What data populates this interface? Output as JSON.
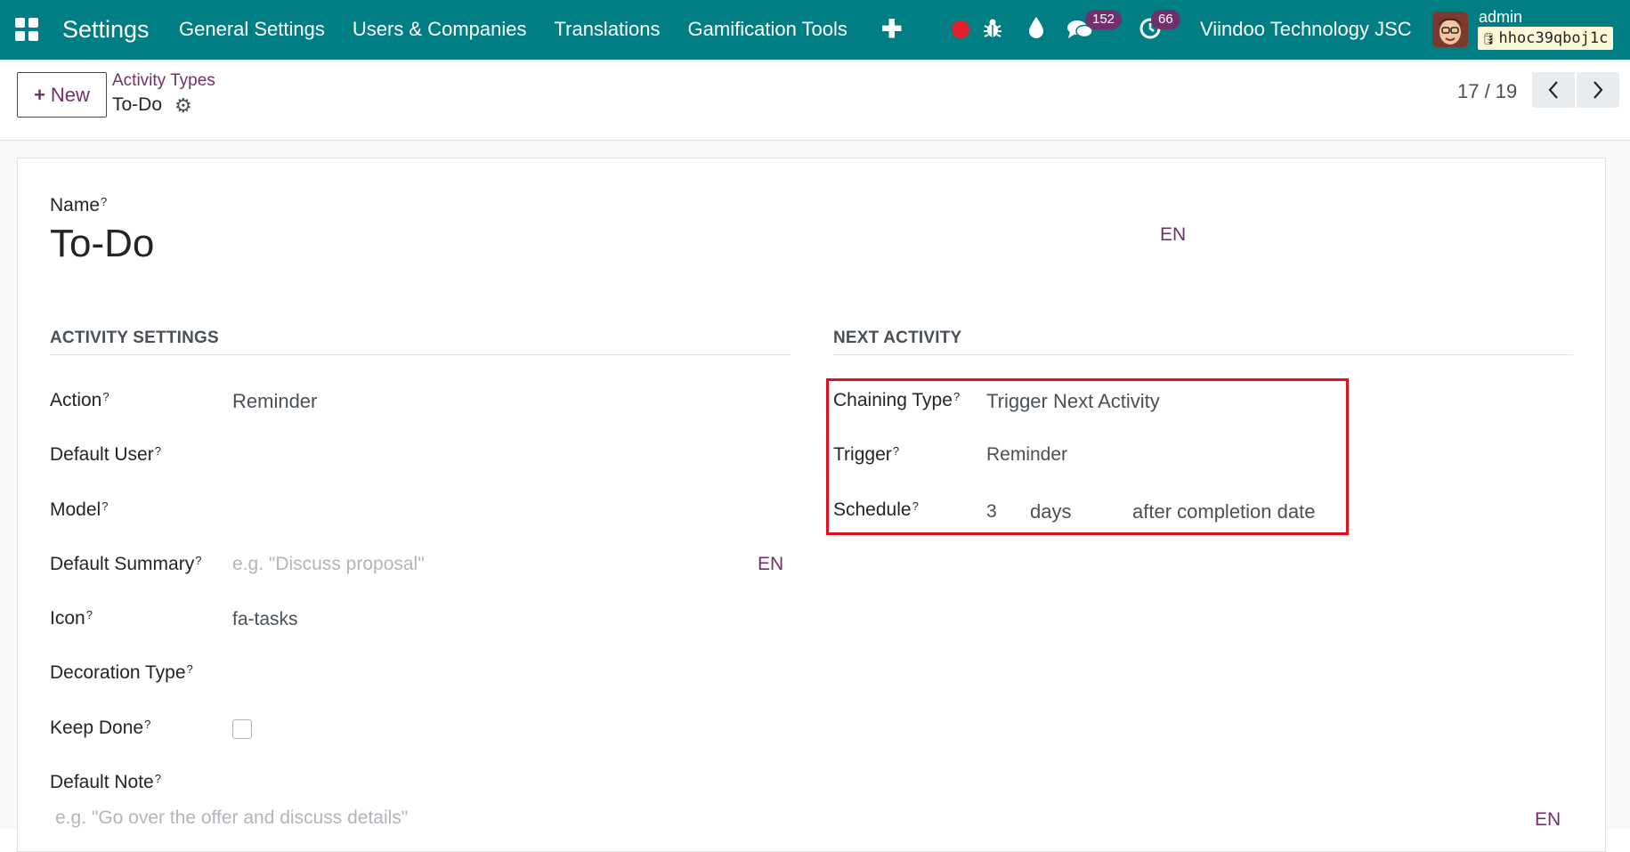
{
  "navbar": {
    "app_title": "Settings",
    "menu": [
      "General Settings",
      "Users & Companies",
      "Translations",
      "Gamification Tools"
    ],
    "messages_count": "152",
    "activities_count": "66",
    "company": "Viindoo Technology JSC",
    "user_name": "admin",
    "database": "hhoc39qboj1c",
    "colors": {
      "bar": "#017e84",
      "badge": "#71306b",
      "record": "#e0202a"
    }
  },
  "control_panel": {
    "new_label": "New",
    "breadcrumb_parent": "Activity Types",
    "breadcrumb_current": "To-Do",
    "pager": "17 / 19"
  },
  "form": {
    "name_label": "Name",
    "name_value": "To-Do",
    "name_lang": "EN",
    "activity_settings": {
      "title": "ACTIVITY SETTINGS",
      "action_label": "Action",
      "action_value": "Reminder",
      "default_user_label": "Default User",
      "model_label": "Model",
      "default_summary_label": "Default Summary",
      "default_summary_placeholder": "e.g. \"Discuss proposal\"",
      "default_summary_lang": "EN",
      "icon_label": "Icon",
      "icon_value": "fa-tasks",
      "decoration_type_label": "Decoration Type",
      "keep_done_label": "Keep Done",
      "keep_done_checked": false,
      "default_note_label": "Default Note",
      "default_note_placeholder": "e.g. \"Go over the offer and discuss details\"",
      "default_note_lang": "EN"
    },
    "next_activity": {
      "title": "NEXT ACTIVITY",
      "chaining_type_label": "Chaining Type",
      "chaining_type_value": "Trigger Next Activity",
      "trigger_label": "Trigger",
      "trigger_value": "Reminder",
      "schedule_label": "Schedule",
      "schedule_number": "3",
      "schedule_unit": "days",
      "schedule_from": "after completion date"
    },
    "help_marker": "?"
  },
  "annotation": {
    "color": "#e0101f"
  }
}
